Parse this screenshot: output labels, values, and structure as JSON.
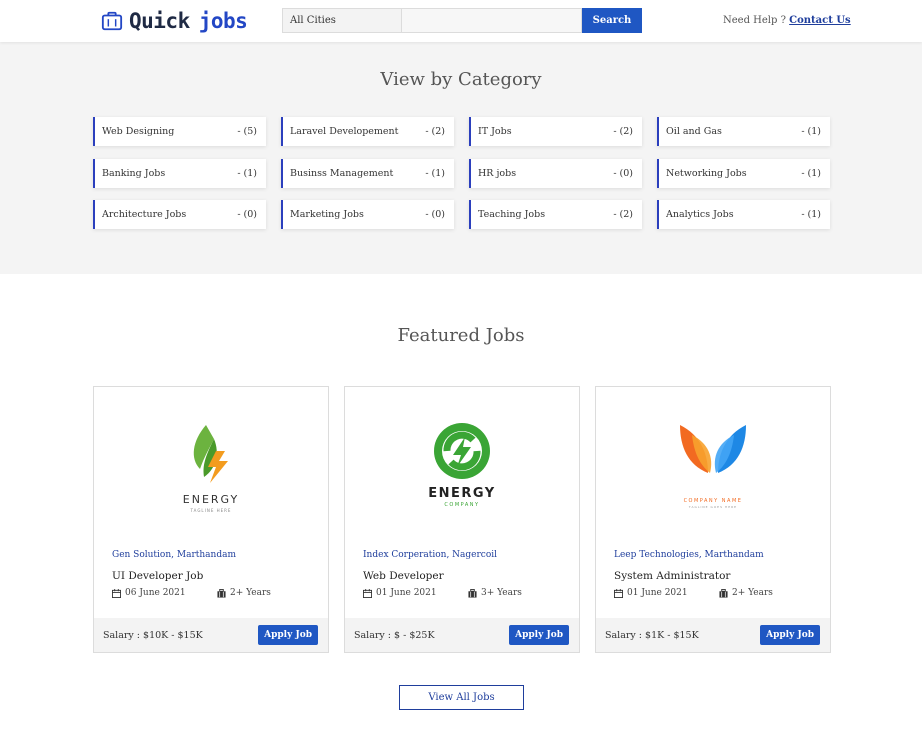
{
  "header": {
    "logo_part1": "Quick",
    "logo_part2": "jobs",
    "city_select": "All Cities",
    "search_placeholder": "",
    "search_label": "Search",
    "help_text": "Need Help ?",
    "contact_label": "Contact Us"
  },
  "categories": {
    "title": "View by Category",
    "items": [
      {
        "name": "Web Designing",
        "count": "-  (5)"
      },
      {
        "name": "Laravel Developement",
        "count": "-  (2)"
      },
      {
        "name": "IT Jobs",
        "count": "-  (2)"
      },
      {
        "name": "Oil and Gas",
        "count": "-  (1)"
      },
      {
        "name": "Banking Jobs",
        "count": "-  (1)"
      },
      {
        "name": "Businss Management",
        "count": "-  (1)"
      },
      {
        "name": "HR jobs",
        "count": "-  (0)"
      },
      {
        "name": "Networking Jobs",
        "count": "-  (1)"
      },
      {
        "name": "Architecture Jobs",
        "count": "-  (0)"
      },
      {
        "name": "Marketing Jobs",
        "count": "-  (0)"
      },
      {
        "name": "Teaching Jobs",
        "count": "-  (2)"
      },
      {
        "name": "Analytics Jobs",
        "count": "-  (1)"
      }
    ]
  },
  "featured": {
    "title": "Featured Jobs",
    "jobs": [
      {
        "company": "Gen Solution, Marthandam",
        "title": "UI Developer Job",
        "date": "06 June 2021",
        "experience": "2+ Years",
        "salary": "Salary : $10K - $15K",
        "apply_label": "Apply Job",
        "logo_text": "ENERGY",
        "logo_tagline": "TAGLINE HERE"
      },
      {
        "company": "Index Corperation, Nagercoil",
        "title": "Web Developer",
        "date": "01 June 2021",
        "experience": "3+ Years",
        "salary": "Salary : $ - $25K",
        "apply_label": "Apply Job",
        "logo_text": "ENERGY",
        "logo_tagline": "COMPANY"
      },
      {
        "company": "Leep Technologies, Marthandam",
        "title": "System Administrator",
        "date": "01 June 2021",
        "experience": "2+ Years",
        "salary": "Salary : $1K - $15K",
        "apply_label": "Apply Job",
        "logo_text": "COMPANY NAME",
        "logo_tagline": "TAGLINE GOES HERE"
      }
    ],
    "view_all_label": "View All Jobs"
  },
  "colors": {
    "accent": "#1f57c3",
    "brand_dark": "#1f2a44",
    "link": "#1f3e9c",
    "category_border": "#2b3fbd"
  }
}
